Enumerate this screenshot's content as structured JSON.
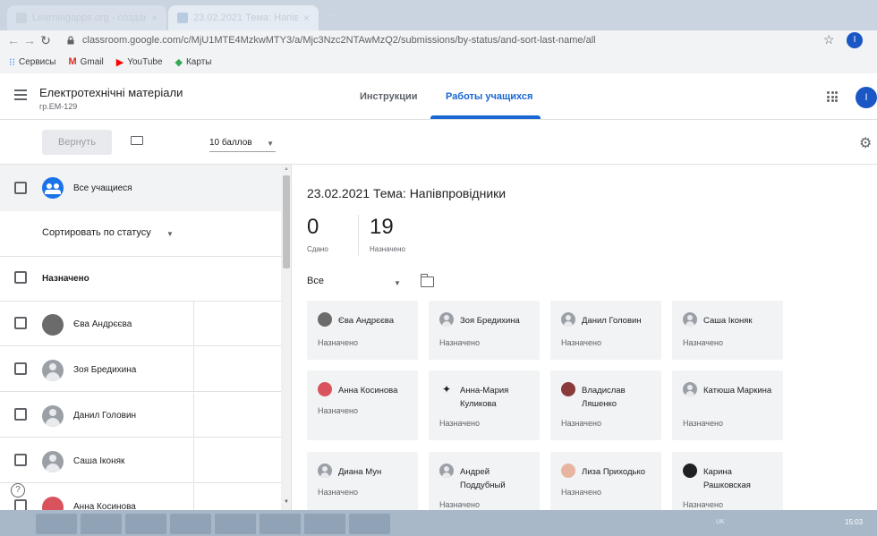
{
  "browser": {
    "tabs": [
      {
        "label": "Learningapps.org - создание м...",
        "close": "×"
      },
      {
        "label": "23.02.2021 Тема: Напівпровідн...",
        "close": "×"
      }
    ],
    "new_tab": "+",
    "url": "classroom.google.com/c/MjU1MTE4MzkwMTY3/a/Mjc3Nzc2NTAwMzQ2/submissions/by-status/and-sort-last-name/all",
    "profile_initial": "I",
    "bookmarks": [
      {
        "label": "Сервисы",
        "icon": "apps-icon"
      },
      {
        "label": "Gmail",
        "icon": "gmail-icon"
      },
      {
        "label": "YouTube",
        "icon": "youtube-icon"
      },
      {
        "label": "Карты",
        "icon": "maps-icon"
      }
    ]
  },
  "app": {
    "class_title": "Електротехнічні матеріали",
    "class_subtitle": "гр.ЕМ-129",
    "tab_instructions": "Инструкции",
    "tab_student_work": "Работы учащихся",
    "user_initial": "I"
  },
  "toolbar": {
    "return_label": "Вернуть",
    "points": "10 баллов"
  },
  "left_panel": {
    "all_students": "Все учащиеся",
    "sort_label": "Сортировать по статусу",
    "section_label": "Назначено",
    "students": [
      {
        "name": "Єва Андрєєва"
      },
      {
        "name": "Зоя Бредихина"
      },
      {
        "name": "Данил Головин"
      },
      {
        "name": "Саша Іконяк"
      },
      {
        "name": "Анна Косинова"
      }
    ],
    "help": "?"
  },
  "assignment": {
    "title": "23.02.2021 Тема: Напівпровідники",
    "submitted_count": "0",
    "submitted_label": "Сдано",
    "assigned_count": "19",
    "assigned_label": "Назначено",
    "filter": "Все",
    "cards": [
      {
        "name": "Єва Андрєєва",
        "status": "Назначено"
      },
      {
        "name": "Зоя Бредихина",
        "status": "Назначено"
      },
      {
        "name": "Данил Головин",
        "status": "Назначено"
      },
      {
        "name": "Саша Іконяк",
        "status": "Назначено"
      },
      {
        "name": "Анна Косинова",
        "status": "Назначено"
      },
      {
        "name": "Анна-Мария Куликова",
        "status": "Назначено"
      },
      {
        "name": "Владислав Ляшенко",
        "status": "Назначено"
      },
      {
        "name": "Катюша Маркина",
        "status": "Назначено"
      },
      {
        "name": "Диана Мун",
        "status": "Назначено"
      },
      {
        "name": "Андрей Поддубный",
        "status": "Назначено"
      },
      {
        "name": "Лиза Приходько",
        "status": "Назначено"
      },
      {
        "name": "Карина Рашковская",
        "status": "Назначено"
      }
    ]
  },
  "taskbar": {
    "lang": "UK",
    "time": "15:03"
  },
  "colors": {
    "accent": "#1967d2",
    "card_bg": "#f1f3f4"
  }
}
